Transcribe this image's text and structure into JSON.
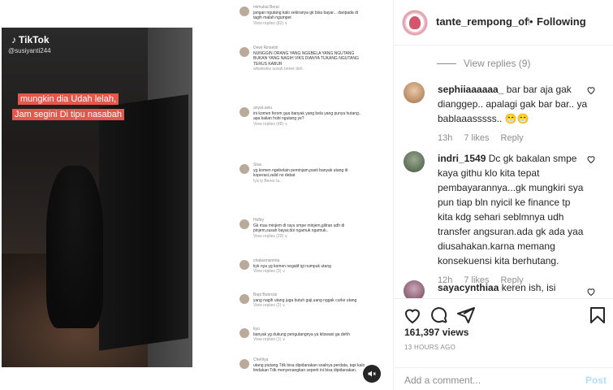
{
  "media": {
    "tiktok_logo": "TikTok",
    "tiktok_user": "@susiyanti244",
    "caption": "mungkin dia Udah lelah, Jam segini Di tipu nasabah",
    "embedded_comments": [
      {
        "name": "mimukal Berai",
        "text": "jangan ngutang kalo sekiranya gk bisa bayar... daripada di tagih malah ngumpet",
        "meta": "View replies (82) ∨"
      },
      {
        "name": "Dewi Ririsetin",
        "text": "NUNGGIN ORANG YANG NGEBELA YANG NGUTANG BUKAN YANG NAGIH VIKS DIANYA TUKANG NGUTANG TERUS KABUR",
        "meta": "wkwkwkw susah bener deh."
      },
      {
        "name": "anyar.ueiu",
        "text": "ini komen ferom gua banyak yang bela yang punya hutang.. apa kalian hobi ngutang ye?",
        "meta": "View replies (48) ∨"
      },
      {
        "name": "Sisa",
        "text": "yg komen ngebelain peminjam,pasti banyak utang di koperasi,valid no debat",
        "meta": "Iya ty Bener tu.."
      },
      {
        "name": "Hofiry",
        "text": "Gk mau minjem di rayu smpe minjem,giliran udh di pinjem,susah bayar,doi ngamuk ngamuk..",
        "meta": "View replies (29) ∨"
      },
      {
        "name": "chalasmanmla",
        "text": "kyk nya yg komen negatif igi numpuk utang",
        "meta": "View replies (3) ∨"
      },
      {
        "name": "Bapi Bunnsis",
        "text": "yang nagih utang juga butuh gaji,uang nggak curke utang",
        "meta": "View replies (2) ∨"
      },
      {
        "name": "kyu",
        "text": "banyak yg dukung pengutangnya ya kitswani ga dehh",
        "meta": "View replies (1) ∨"
      },
      {
        "name": "Chehlya",
        "text": "utang piutang Tdk bisa dipidanakan soalnya perdata, tapi kalo tindakan Tdk menyenangkan seperti ini bisa dipidanakan.",
        "meta": ""
      }
    ]
  },
  "post": {
    "username": "tante_rempong_offficial",
    "separator": "•",
    "follow_label": "Following",
    "view_replies": "View replies (9)",
    "comments": [
      {
        "user": "sephiiaaaaaa_",
        "text": "bar bar aja gak dianggep.. apalagi gak bar bar.. ya bablaaasssss.. 😁😁",
        "time": "13h",
        "likes": "7 likes",
        "reply": "Reply"
      },
      {
        "user": "indri_1549",
        "text": "Dc gk bakalan smpe kaya githu klo kita tepat pembayarannya...gk mungkiri sya pun tiap bln nyicil ke finance tp kita kdg sehari seblmnya udh transfer angsuran.ada gk ada yaa diusahakan.karna memang konsekuensi kita berhutang.",
        "time": "12h",
        "likes": "7 likes",
        "reply": "Reply"
      },
      {
        "user": "sayacynthiaa",
        "text": "keren ish, isi",
        "time": "",
        "likes": "",
        "reply": ""
      }
    ],
    "views": "161,397 views",
    "time_ago": "13 HOURS AGO",
    "add_comment_placeholder": "Add a comment...",
    "post_label": "Post"
  },
  "icons": {
    "like": "heart-icon",
    "comment": "comment-icon",
    "share": "send-icon",
    "save": "bookmark-icon",
    "mute": "mute-icon",
    "comment_like": "heart-icon"
  },
  "colors": {
    "caption_bg": "#e4574d",
    "post_button": "#b2dffc",
    "muted_text": "#8e8e8e"
  }
}
